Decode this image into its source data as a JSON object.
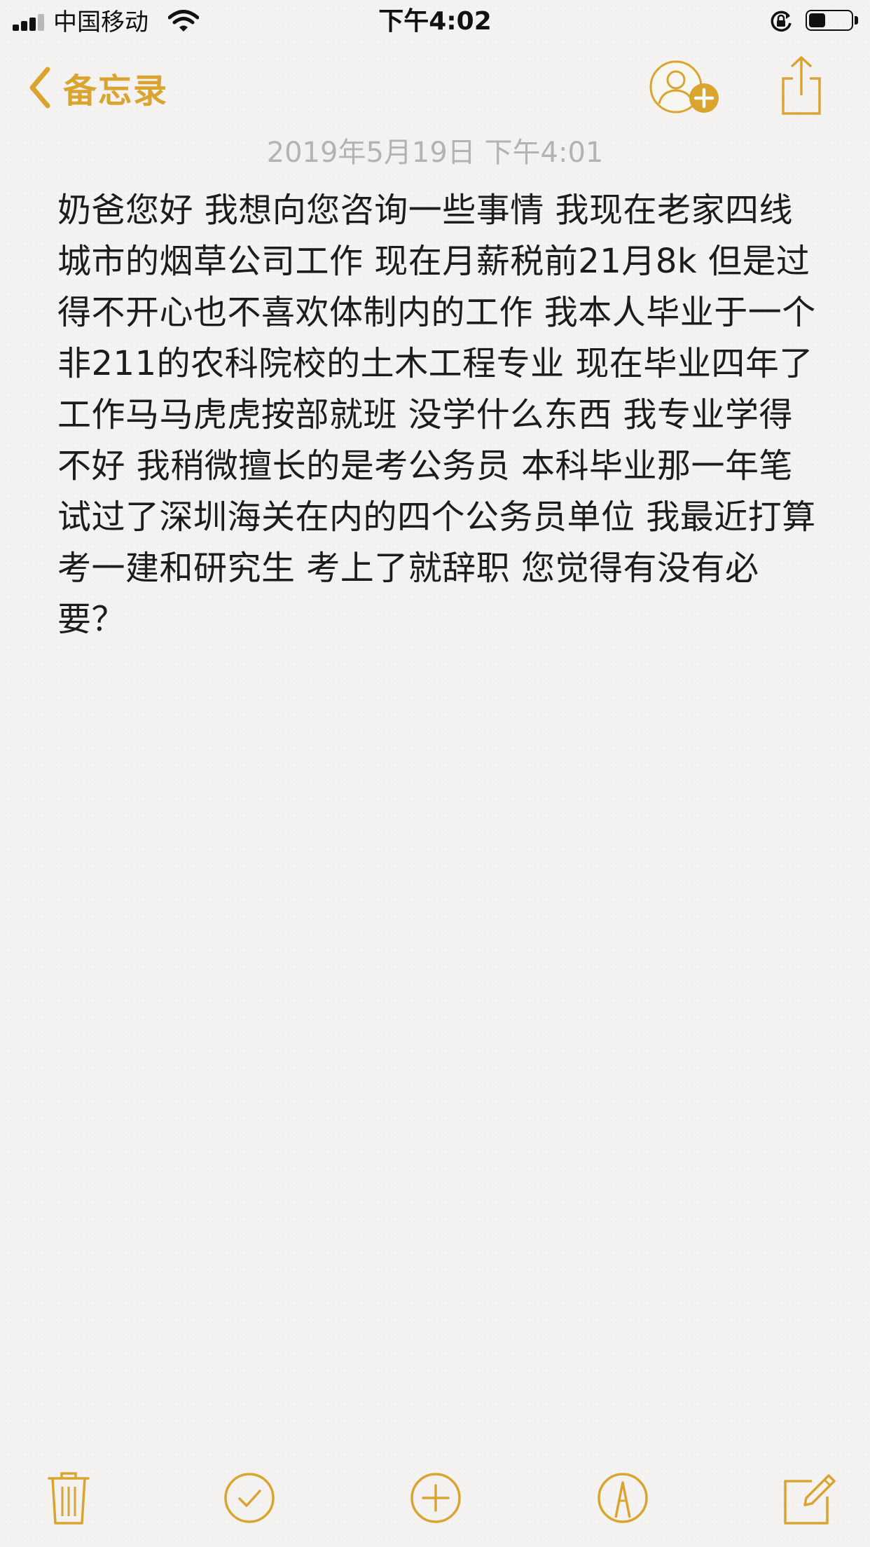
{
  "status_bar": {
    "carrier": "中国移动",
    "time": "下午4:02",
    "signal_bars": 3,
    "signal_bars_total": 4,
    "battery_level": 0.4,
    "icons": [
      "cellular-signal-icon",
      "wifi-icon",
      "rotation-lock-icon",
      "battery-icon"
    ]
  },
  "nav": {
    "back_label": "备忘录",
    "icons": [
      "chevron-left-icon",
      "add-people-icon",
      "share-icon"
    ]
  },
  "note": {
    "date": "2019年5月19日 下午4:01",
    "body": "奶爸您好 我想向您咨询一些事情 我现在老家四线城市的烟草公司工作 现在月薪税前21月8k 但是过得不开心也不喜欢体制内的工作 我本人毕业于一个非211的农科院校的土木工程专业 现在毕业四年了 工作马马虎虎按部就班 没学什么东西 我专业学得不好 我稍微擅长的是考公务员 本科毕业那一年笔试过了深圳海关在内的四个公务员单位 我最近打算考一建和研究生 考上了就辞职 您觉得有没有必要？"
  },
  "toolbar": {
    "icons": [
      "trash-icon",
      "checklist-icon",
      "add-icon",
      "markup-icon",
      "compose-icon"
    ]
  },
  "colors": {
    "accent": "#d9a530",
    "background": "#f4f3f1",
    "text": "#1c1c1c",
    "date_text": "#b3b3b3"
  }
}
